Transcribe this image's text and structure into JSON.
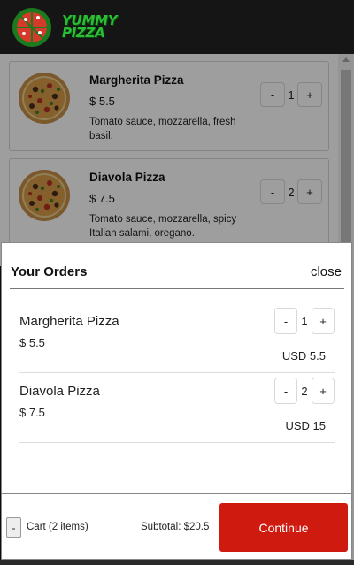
{
  "header": {
    "logo_line1": "YUMMY",
    "logo_line2": "PIZZA",
    "logo_icon": "pizza-icon",
    "brand_color": "#2bbd34"
  },
  "menu": {
    "items": [
      {
        "name": "Margherita Pizza",
        "price": "$ 5.5",
        "description": "Tomato sauce, mozzarella, fresh basil.",
        "qty_minus": "-",
        "qty": "1",
        "qty_plus": "+"
      },
      {
        "name": "Diavola Pizza",
        "price": "$ 7.5",
        "description": "Tomato sauce, mozzarella, spicy Italian salami, oregano.",
        "qty_minus": "-",
        "qty": "2",
        "qty_plus": "+"
      }
    ]
  },
  "orders": {
    "title": "Your Orders",
    "close_label": "close",
    "items": [
      {
        "name": "Margherita Pizza",
        "price": "$ 5.5",
        "qty_minus": "-",
        "qty": "1",
        "qty_plus": "+",
        "total": "USD 5.5"
      },
      {
        "name": "Diavola Pizza",
        "price": "$ 7.5",
        "qty_minus": "-",
        "qty": "2",
        "qty_plus": "+",
        "total": "USD 15"
      }
    ]
  },
  "footer": {
    "toggle_label": "-",
    "cart_label": "Cart (2 items)",
    "subtotal": "Subtotal: $20.5",
    "continue_label": "Continue",
    "continue_color": "#cf1a10"
  }
}
